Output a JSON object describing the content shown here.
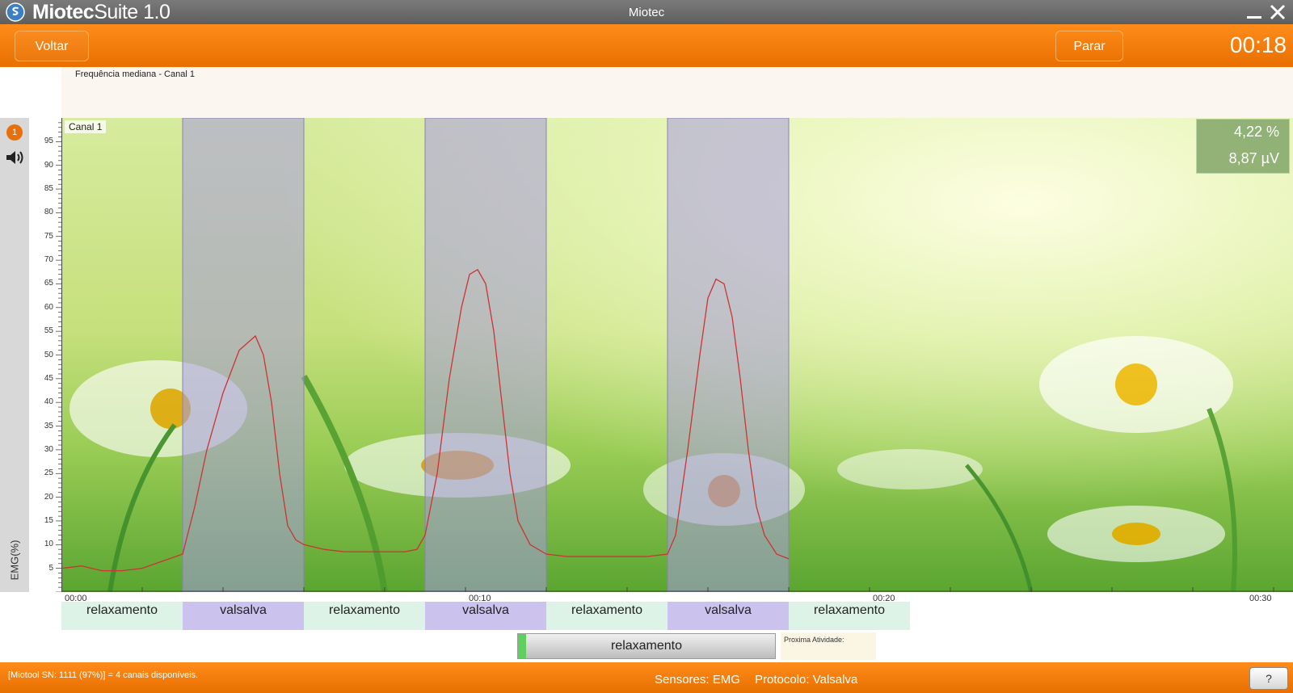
{
  "window": {
    "app_name_bold": "Miotec",
    "app_name_rest": "Suite 1.0",
    "title": "Miotec"
  },
  "header": {
    "back_label": "Voltar",
    "stop_label": "Parar",
    "timer": "00:18"
  },
  "median_panel": {
    "title": "Frequência mediana - Canal 1"
  },
  "channel": {
    "badge": "1",
    "name": "Canal 1",
    "y_axis_label": "EMG(%)",
    "readout_percent": "4,22 %",
    "readout_voltage": "8,87 µV"
  },
  "colors": {
    "accent": "#f07d0b",
    "titlebar": "#6b6b6b",
    "valsalva_band": "#a89be0",
    "signal_line": "#cc3333"
  },
  "chart_data": {
    "type": "line",
    "title": "",
    "xlabel": "",
    "ylabel": "EMG(%)",
    "ylim": [
      0,
      100
    ],
    "xlim": [
      0,
      30
    ],
    "y_ticks": [
      5,
      10,
      15,
      20,
      25,
      30,
      35,
      40,
      45,
      50,
      55,
      60,
      65,
      70,
      75,
      80,
      85,
      90,
      95
    ],
    "x_tick_labels": [
      {
        "x": 0,
        "label": "00:00"
      },
      {
        "x": 10,
        "label": "00:10"
      },
      {
        "x": 20,
        "label": "00:20"
      },
      {
        "x": 30,
        "label": "00:30"
      }
    ],
    "phases": [
      {
        "start": 0,
        "end": 3,
        "label": "relaxamento",
        "type": "relax"
      },
      {
        "start": 3,
        "end": 6,
        "label": "valsalva",
        "type": "valsalva"
      },
      {
        "start": 6,
        "end": 9,
        "label": "relaxamento",
        "type": "relax"
      },
      {
        "start": 9,
        "end": 12,
        "label": "valsalva",
        "type": "valsalva"
      },
      {
        "start": 12,
        "end": 15,
        "label": "relaxamento",
        "type": "relax"
      },
      {
        "start": 15,
        "end": 18,
        "label": "valsalva",
        "type": "valsalva"
      },
      {
        "start": 18,
        "end": 21,
        "label": "relaxamento",
        "type": "relax"
      }
    ],
    "series": [
      {
        "x": [
          0,
          0.5,
          1,
          1.5,
          2,
          2.5,
          3,
          3.3,
          3.6,
          4,
          4.4,
          4.8,
          5.0,
          5.2,
          5.4,
          5.6,
          5.8,
          6,
          6.5,
          7,
          7.5,
          8,
          8.5,
          8.8,
          9,
          9.3,
          9.6,
          9.9,
          10.1,
          10.3,
          10.5,
          10.7,
          10.9,
          11.1,
          11.3,
          11.6,
          12,
          12.5,
          13,
          13.5,
          14,
          14.5,
          15,
          15.2,
          15.5,
          15.8,
          16.0,
          16.2,
          16.4,
          16.6,
          16.8,
          17.0,
          17.2,
          17.4,
          17.7,
          18
        ],
        "y": [
          5,
          5.5,
          4.5,
          4.5,
          5,
          6.5,
          8,
          18,
          30,
          42,
          51,
          54,
          50,
          40,
          25,
          14,
          11,
          10,
          9,
          8.5,
          8.5,
          8.5,
          8.5,
          9,
          12,
          25,
          45,
          60,
          67,
          68,
          65,
          55,
          40,
          25,
          15,
          10,
          8,
          7.5,
          7.5,
          7.5,
          7.5,
          7.5,
          8,
          12,
          30,
          50,
          62,
          66,
          65,
          58,
          45,
          30,
          18,
          12,
          8,
          7
        ]
      }
    ]
  },
  "activity": {
    "current": "relaxamento",
    "progress_percent": 3,
    "next_label": "Proxima Atividade:"
  },
  "footer": {
    "device_status": "[Miotool SN: 1111 (97%)] = 4 canais disponíveis.",
    "sensors": "Sensores: EMG",
    "protocol": "Protocolo: Valsalva",
    "help_label": "?"
  }
}
